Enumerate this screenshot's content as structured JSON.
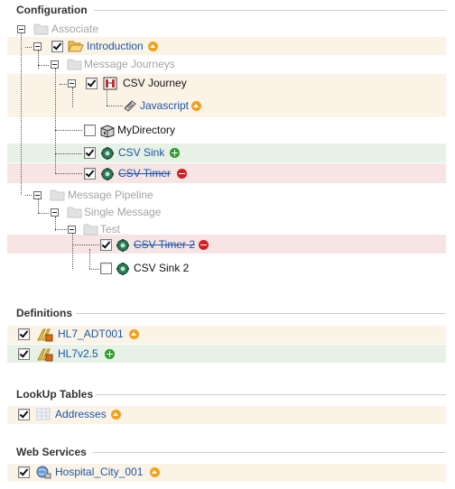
{
  "sections": {
    "configuration": {
      "title": "Configuration"
    },
    "definitions": {
      "title": "Definitions"
    },
    "lookup": {
      "title": "LookUp Tables"
    },
    "webservices": {
      "title": "Web Services"
    }
  },
  "tree": {
    "associate": "Associate",
    "introduction": "Introduction",
    "message_journeys": "Message Journeys",
    "csv_journey": "CSV Journey",
    "javascript": "Javascript",
    "mydirectory": "MyDirectory",
    "csv_sink": "CSV Sink",
    "csv_timer": "CSV Timer",
    "message_pipeline": "Message Pipeline",
    "single_message": "Single Message",
    "test": "Test",
    "csv_timer_2": "CSV Timer 2",
    "csv_sink_2": "CSV Sink 2"
  },
  "definitions": {
    "hl7_adt001": "HL7_ADT001",
    "hl7v25": "HL7v2.5"
  },
  "lookup": {
    "addresses": "Addresses"
  },
  "webservices": {
    "hospital_city": "Hospital_City_001"
  },
  "icons": {
    "status_changed": "warning-badge-icon",
    "status_added": "plus-badge-icon",
    "status_removed": "minus-badge-icon"
  },
  "colors": {
    "changed_row": "#fcf3e7",
    "added_row": "#e7f1e6",
    "removed_row": "#f7e4e4",
    "link": "#1a57a8"
  }
}
